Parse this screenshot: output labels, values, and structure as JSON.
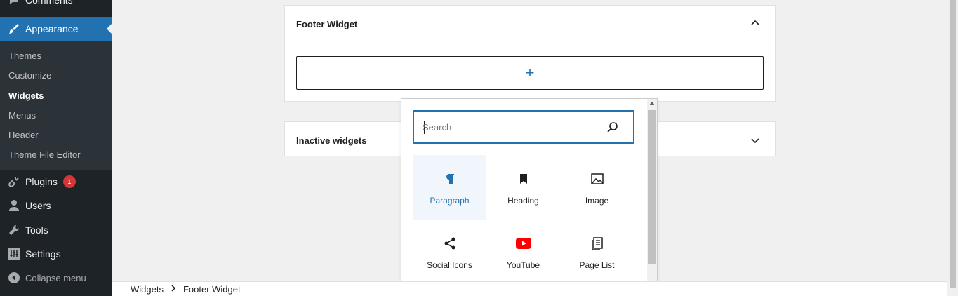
{
  "sidebar": {
    "comments_label": "Comments",
    "appearance_label": "Appearance",
    "submenu": [
      "Themes",
      "Customize",
      "Widgets",
      "Menus",
      "Header",
      "Theme File Editor"
    ],
    "plugins_label": "Plugins",
    "plugins_badge": "1",
    "users_label": "Users",
    "tools_label": "Tools",
    "settings_label": "Settings",
    "collapse_label": "Collapse menu"
  },
  "widgets": {
    "footer_title": "Footer Widget",
    "inactive_title": "Inactive widgets",
    "add_block_symbol": "+"
  },
  "inserter": {
    "search_placeholder": "Search",
    "blocks": [
      {
        "label": "Paragraph",
        "icon": "paragraph-icon"
      },
      {
        "label": "Heading",
        "icon": "bookmark-icon"
      },
      {
        "label": "Image",
        "icon": "image-icon"
      },
      {
        "label": "Social Icons",
        "icon": "share-icon"
      },
      {
        "label": "YouTube",
        "icon": "youtube-icon"
      },
      {
        "label": "Page List",
        "icon": "page-list-icon"
      }
    ]
  },
  "breadcrumb": {
    "root": "Widgets",
    "current": "Footer Widget"
  },
  "colors": {
    "sidebar_bg": "#1d2327",
    "submenu_bg": "#2c3338",
    "accent": "#2271b1",
    "badge": "#d63638",
    "youtube_red": "#ff0000"
  }
}
